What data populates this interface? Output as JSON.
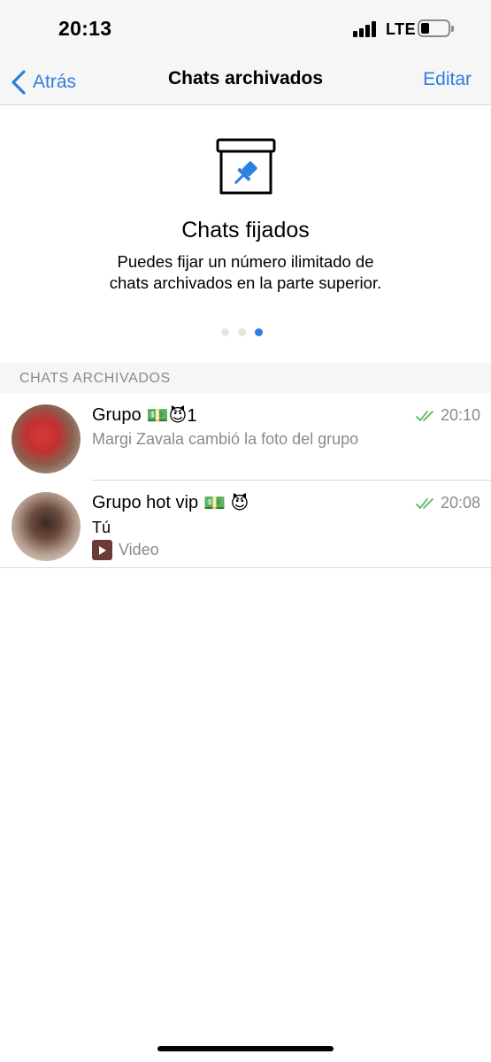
{
  "status_bar": {
    "time": "20:13",
    "network": "LTE"
  },
  "nav": {
    "back_label": "Atrás",
    "title": "Chats archivados",
    "edit_label": "Editar"
  },
  "promo": {
    "title": "Chats fijados",
    "line1": "Puedes fijar un número ilimitado de",
    "line2": "chats archivados en la parte superior.",
    "page_count": 3,
    "active_page": 3
  },
  "section_header": "CHATS ARCHIVADOS",
  "chats": [
    {
      "name": "Grupo",
      "emojis": "💵😈1",
      "time": "20:10",
      "preview": "Margi Zavala cambió la foto del grupo"
    },
    {
      "name": "Grupo hot vip",
      "emojis": "💵 😈",
      "time": "20:08",
      "sender": "Tú",
      "media_label": "Video"
    }
  ],
  "colors": {
    "accent": "#2d7fe2",
    "read_ticks": "#5bb75b",
    "secondary_text": "#8a8a8e"
  }
}
